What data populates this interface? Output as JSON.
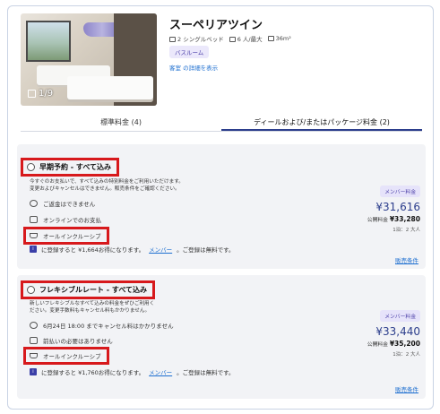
{
  "room": {
    "name": "スーペリアツイン",
    "photo_count": "1/9",
    "amenities": [
      "2 シングルベッド",
      "6 人/最大",
      "36m²"
    ],
    "tag": "バスルーム",
    "details_link": "客室 の詳細を表示"
  },
  "tabs": [
    {
      "label": "標準料金 (4)",
      "active": false
    },
    {
      "label": "ディールおよび/またはパッケージ料金 (2)",
      "active": true
    }
  ],
  "rates": [
    {
      "name": "早期予約 - すべて込み",
      "desc_lines": [
        "今すぐのお支払いで、すべて込みの特別料金をご利用いただけます。",
        "変更およびキャンセルはできません。販売条件をご確認ください。"
      ],
      "features": [
        "ご返金はできません",
        "オンラインでのお支払",
        "オールインクルーシブ"
      ],
      "member_text": "に登録すると ¥1,664お得になります。",
      "member_link": "メンバー",
      "member_tail": "。ご登録は無料です。",
      "member_tag": "メンバー料金",
      "price": "¥31,616",
      "public_label": "公開料金",
      "public_price": "¥33,280",
      "per_night": "1泊：2 大人",
      "terms": "販売条件"
    },
    {
      "name": "フレキシブルレート - すべて込み",
      "desc_lines": [
        "新しいフレキシブルなすべて込みの料金をぜひご利用く",
        "ださい。変更手数料もキャンセル料もかかりません。"
      ],
      "features": [
        "6月24日 18:00 までキャンセル料はかかりません",
        "前払いの必要はありません",
        "オールインクルーシブ"
      ],
      "member_text": "に登録すると ¥1,760お得になります。",
      "member_link": "メンバー",
      "member_tail": "。ご登録は無料です。",
      "member_tag": "メンバー料金",
      "price": "¥33,440",
      "public_label": "公開料金",
      "public_price": "¥35,200",
      "per_night": "1泊：2 大人",
      "terms": "販売条件"
    }
  ]
}
